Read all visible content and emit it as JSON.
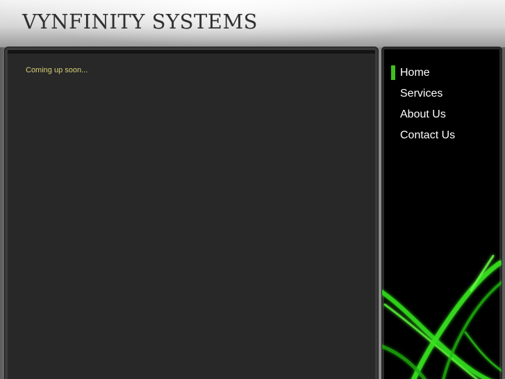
{
  "header": {
    "title": "VYNFINITY SYSTEMS"
  },
  "main": {
    "text": "Coming up soon..."
  },
  "nav": {
    "items": [
      {
        "label": "Home",
        "active": true
      },
      {
        "label": "Services",
        "active": false
      },
      {
        "label": "About Us",
        "active": false
      },
      {
        "label": "Contact Us",
        "active": false
      }
    ]
  },
  "colors": {
    "accent": "#3ec21a",
    "main_text": "#d8cf77",
    "panel": "#282828"
  }
}
